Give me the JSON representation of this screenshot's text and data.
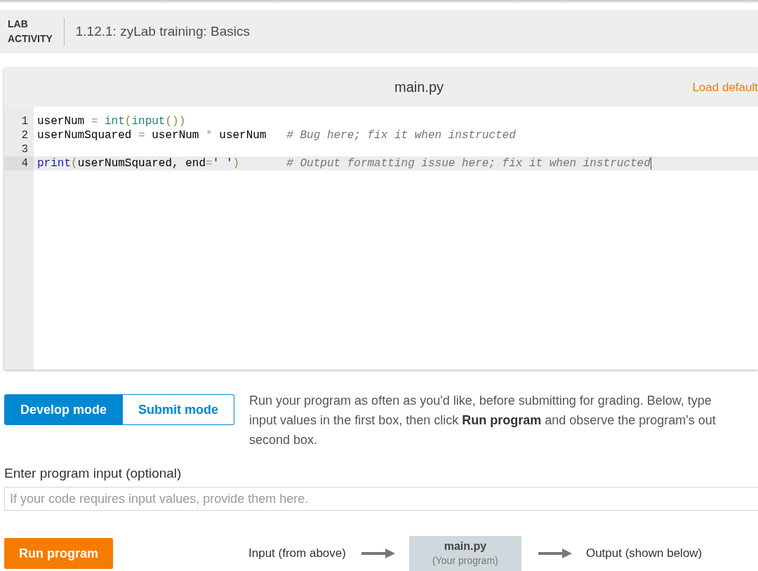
{
  "header": {
    "label": "LAB ACTIVITY",
    "title": "1.12.1: zyLab training: Basics"
  },
  "editor": {
    "filename": "main.py",
    "load_default": "Load default",
    "lines": [
      {
        "number": "1",
        "active": false,
        "tokens": [
          {
            "kind": "name",
            "text": "userNum "
          },
          {
            "kind": "operator",
            "text": "= "
          },
          {
            "kind": "builtin",
            "text": "int"
          },
          {
            "kind": "paren",
            "text": "("
          },
          {
            "kind": "builtin",
            "text": "input"
          },
          {
            "kind": "paren",
            "text": "())"
          }
        ]
      },
      {
        "number": "2",
        "active": false,
        "tokens": [
          {
            "kind": "name",
            "text": "userNumSquared "
          },
          {
            "kind": "operator",
            "text": "="
          },
          {
            "kind": "name",
            "text": " userNum "
          },
          {
            "kind": "operator",
            "text": "*"
          },
          {
            "kind": "name",
            "text": " userNum   "
          },
          {
            "kind": "comment",
            "text": "# Bug here; fix it when instructed"
          }
        ]
      },
      {
        "number": "3",
        "active": false
      },
      {
        "number": "4",
        "active": true,
        "tokens": [
          {
            "kind": "keyword",
            "text": "print"
          },
          {
            "kind": "paren",
            "text": "("
          },
          {
            "kind": "name",
            "text": "userNumSquared, end"
          },
          {
            "kind": "operator",
            "text": "="
          },
          {
            "kind": "string",
            "text": "' '"
          },
          {
            "kind": "paren",
            "text": ")       "
          },
          {
            "kind": "comment",
            "text": "# Output formatting issue here; fix it when instructed"
          }
        ]
      }
    ]
  },
  "modes": [
    {
      "label": "Develop mode",
      "selected": true
    },
    {
      "label": "Submit mode",
      "selected": false
    }
  ],
  "instructions": [
    "Run your program as often as you'd like, before submitting for grading. Below, type",
    "input values in the first box, then click **Run program** and observe the program's out",
    "second box."
  ],
  "program_input": {
    "label": "Enter program input (optional)",
    "placeholder": "If your code requires input values, provide them here."
  },
  "run_button": "Run program",
  "flow": {
    "input_label": "Input (from above)",
    "program_name": "main.py",
    "program_caption": "(Your program)",
    "output_label": "Output (shown below)"
  }
}
